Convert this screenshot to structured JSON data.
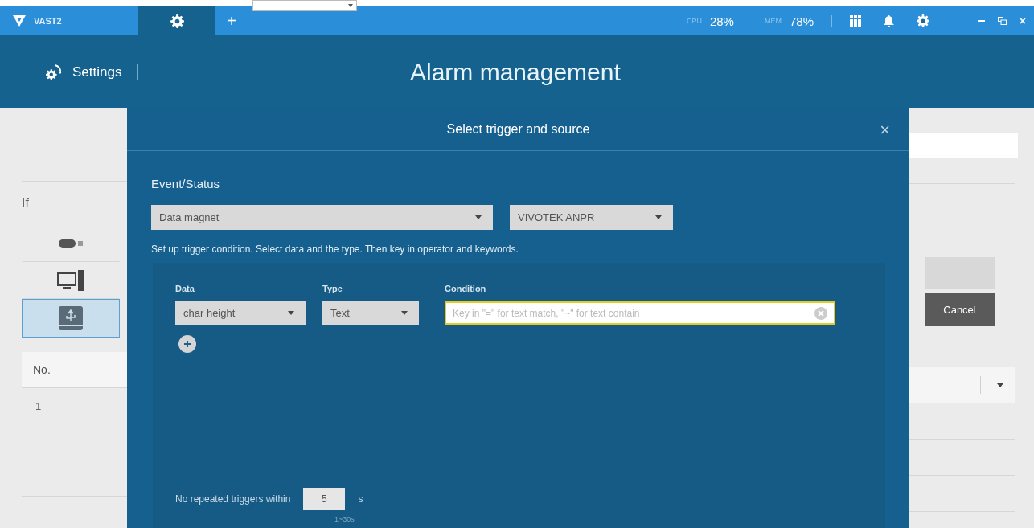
{
  "top_bar": {
    "app_name": "VAST2",
    "tabs": [
      {
        "kind": "settings",
        "selected": true
      },
      {
        "kind": "add",
        "label": "+",
        "selected": false
      }
    ],
    "cpu_label": "CPU",
    "cpu": "28%",
    "mem_label": "MEM",
    "mem": "78%"
  },
  "header": {
    "section": "Settings",
    "title": "Alarm management"
  },
  "background": {
    "if_label": "If",
    "sources": [
      {
        "kind": "camera",
        "selected": false
      },
      {
        "kind": "computer",
        "selected": false
      },
      {
        "kind": "usb-drive",
        "selected": true
      }
    ],
    "table_header": "No.",
    "rows": [
      "1"
    ],
    "cancel_button": "Cancel"
  },
  "modal": {
    "title": "Select trigger and source",
    "close": "×",
    "event_label": "Event/Status",
    "event_dropdown": "Data magnet",
    "source_dropdown": "VIVOTEK ANPR",
    "instruction": "Set up trigger condition. Select data and the type. Then key in operator and keywords.",
    "columns": [
      "Data",
      "Type",
      "Condition"
    ],
    "data_dropdown": "char height",
    "type_dropdown": "Text",
    "condition": {
      "placeholder": "Key in \"=\" for text match, \"~\" for text contain"
    },
    "repeat_label": "No repeated triggers within",
    "repeat_value": "5",
    "repeat_unit": "s",
    "repeat_hint": "1~30s"
  }
}
